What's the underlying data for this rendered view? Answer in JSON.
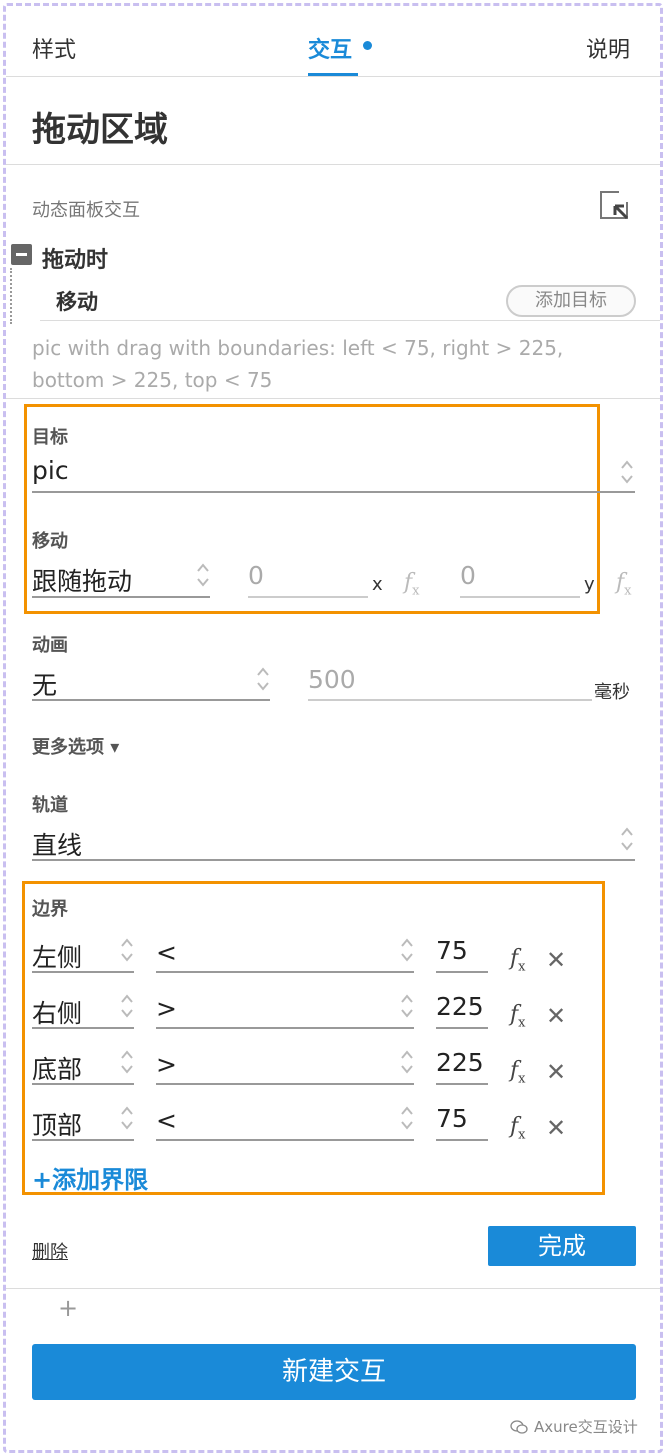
{
  "tabs": [
    {
      "label": "样式"
    },
    {
      "label": "交互"
    },
    {
      "label": "说明"
    }
  ],
  "title": "拖动区域",
  "widget_type_label": "动态面板交互",
  "event": {
    "label": "拖动时"
  },
  "action": {
    "label": "移动",
    "add_target_label": "添加目标"
  },
  "description": "pic with drag  with boundaries: left < 75, right > 225, bottom > 225, top < 75",
  "target": {
    "label": "目标",
    "value": "pic"
  },
  "move": {
    "label": "移动",
    "mode": "跟随拖动",
    "x_value": "0",
    "x_label": "x",
    "y_value": "0",
    "y_label": "y"
  },
  "animation": {
    "label": "动画",
    "value": "无",
    "duration": "500",
    "unit": "毫秒"
  },
  "more_options": "更多选项 ▾",
  "track": {
    "label": "轨道",
    "value": "直线"
  },
  "boundaries": {
    "label": "边界",
    "rows": [
      {
        "side": "左侧",
        "operator": "<",
        "value": "75"
      },
      {
        "side": "右侧",
        "operator": ">",
        "value": "225"
      },
      {
        "side": "底部",
        "operator": ">",
        "value": "225"
      },
      {
        "side": "顶部",
        "operator": "<",
        "value": "75"
      }
    ],
    "add_label": "+添加界限"
  },
  "delete_label": "删除",
  "done_label": "完成",
  "plus_label": "+",
  "new_interaction_label": "新建交互",
  "watermark": "Axure交互设计",
  "fx_label": "f",
  "fx_sub": "x",
  "close_glyph": "✕",
  "colors": {
    "accent": "#1a8ad8",
    "highlight": "#f39200"
  },
  "icons": [
    "popout-icon",
    "collapse-icon",
    "stepper-icon",
    "fx-icon",
    "close-icon",
    "wechat-icon"
  ]
}
